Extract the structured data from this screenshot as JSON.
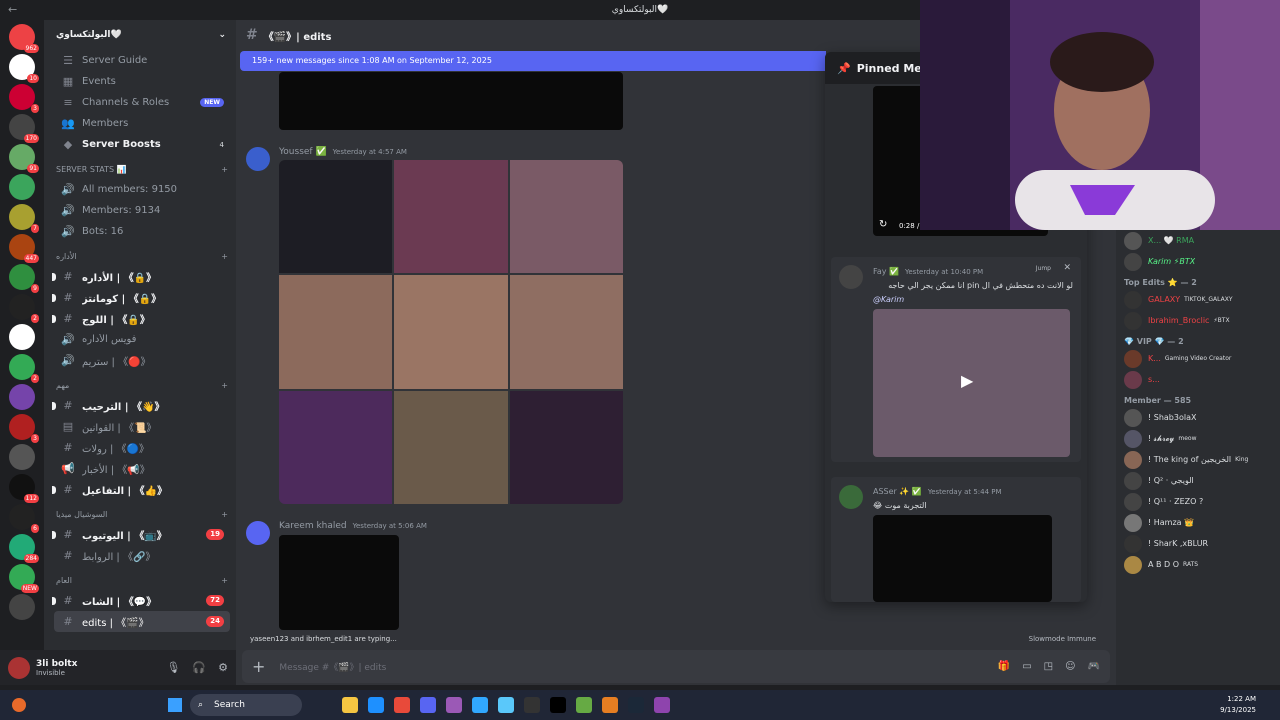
{
  "window": {
    "title": "البولتكساوي🤍"
  },
  "server": {
    "name": "البولتكساوي🤍"
  },
  "channels": {
    "top": [
      {
        "label": "Server Guide"
      },
      {
        "label": "Events"
      },
      {
        "label": "Channels & Roles",
        "pill": "NEW"
      },
      {
        "label": "Members"
      },
      {
        "label": "Server Boosts",
        "count": "4"
      }
    ],
    "stats_category": "SERVER STATS 📊",
    "stats": [
      "All members: 9150",
      "Members: 9134",
      "Bots: 16"
    ],
    "admin_category": "الأداره",
    "admin": [
      "الأداره | 《🔒》",
      "كومانتز | 《🔒》",
      "اللوج | 《🔒》",
      "فويس الأداره",
      "ستريم | 《🔴》"
    ],
    "main_category": "مهم",
    "main": [
      "الترحيب | 《👋》",
      "القوانين | 《📜》",
      "رولات | 《🔵》",
      "الأخبار | 《📢》",
      "التفاعيل | 《👍》"
    ],
    "social_category": "السوشيال ميديا",
    "social": [
      {
        "label": "اليوتيوب | 《📺》",
        "badge": "19"
      },
      {
        "label": "الروابط | 《🔗》"
      }
    ],
    "general_category": "العام",
    "general": [
      {
        "label": "الشات | 《💬》",
        "badge": "72"
      },
      {
        "label": "edits | 《🎬》",
        "badge": "24"
      }
    ]
  },
  "user": {
    "name": "3li boltx",
    "status": "Invisible"
  },
  "chat": {
    "channel": "《🎬》| edits",
    "new_messages": "159+ new messages since 1:08 AM on September 12, 2025",
    "messages": [
      {
        "author": "Youssef ✅",
        "time": "Yesterday at 4:57 AM"
      },
      {
        "author": "Kareem khaled",
        "time": "Yesterday at 5:06 AM"
      }
    ],
    "typing": "yaseen123 and ibrhem_edit1 are typing...",
    "slowmode": "Slowmode Immune",
    "placeholder": "Message #《🎬》| edits"
  },
  "pins": {
    "title": "Pinned Messages",
    "video_time": "0:28 / 0:",
    "items": [
      {
        "author": "Fay ✅",
        "time": "Yesterday at 10:40 PM",
        "jump": "Jump",
        "text": "لو الانت ده متحطش في ال pin انا ممكن يجر الي حاجه",
        "mention": "@Karim"
      },
      {
        "author": "ASSer ✨ ✅",
        "time": "Yesterday at 5:44 PM",
        "text": "😂 التجربة موت"
      }
    ]
  },
  "members": {
    "top": [
      {
        "name": "X... 🤍 RMA",
        "color": "#3ba55c"
      },
      {
        "name": "Karim ⚡BTX",
        "color": "#57f287"
      }
    ],
    "top_edits_header": "Top Edits ⭐ — 2",
    "top_edits": [
      {
        "name": "GALAXY",
        "tag": "TIKTOK_GALAXY",
        "color": "#ed4245"
      },
      {
        "name": "Ibrahim_Broclic",
        "tag": "⚡BTX",
        "color": "#ed4245"
      }
    ],
    "vip_header": "💎 VIP 💎 — 2",
    "vip": [
      {
        "name": "K...",
        "tag": "Gaming Video Creator",
        "color": "#ed4245"
      },
      {
        "name": "s...",
        "tag": "",
        "color": "#ed4245"
      }
    ],
    "member_header": "Member — 585",
    "list": [
      {
        "name": "! Shab3olaX",
        "tag": "",
        "color": "#dbdee1"
      },
      {
        "name": "! 𝓼𝓱𝓻𝓮𝔂",
        "tag": "meow",
        "color": "#dbdee1"
      },
      {
        "name": "! The king of الخريجين",
        "tag": "King",
        "color": "#dbdee1"
      },
      {
        "name": "! Q² · الويجي",
        "tag": "",
        "color": "#dbdee1"
      },
      {
        "name": "! Q¹¹ · ZEZO ?",
        "tag": "",
        "color": "#dbdee1"
      },
      {
        "name": "! Hamza 👑",
        "tag": "",
        "color": "#dbdee1"
      },
      {
        "name": "! SharK ,xBLUR",
        "tag": "",
        "color": "#dbdee1"
      },
      {
        "name": "A B D O",
        "tag": "RATS",
        "color": "#dbdee1"
      }
    ]
  },
  "taskbar": {
    "search": "Search",
    "time": "1:22 AM",
    "date": "9/13/2025"
  },
  "colors": {
    "accent": "#5865f2",
    "danger": "#f23f43"
  }
}
